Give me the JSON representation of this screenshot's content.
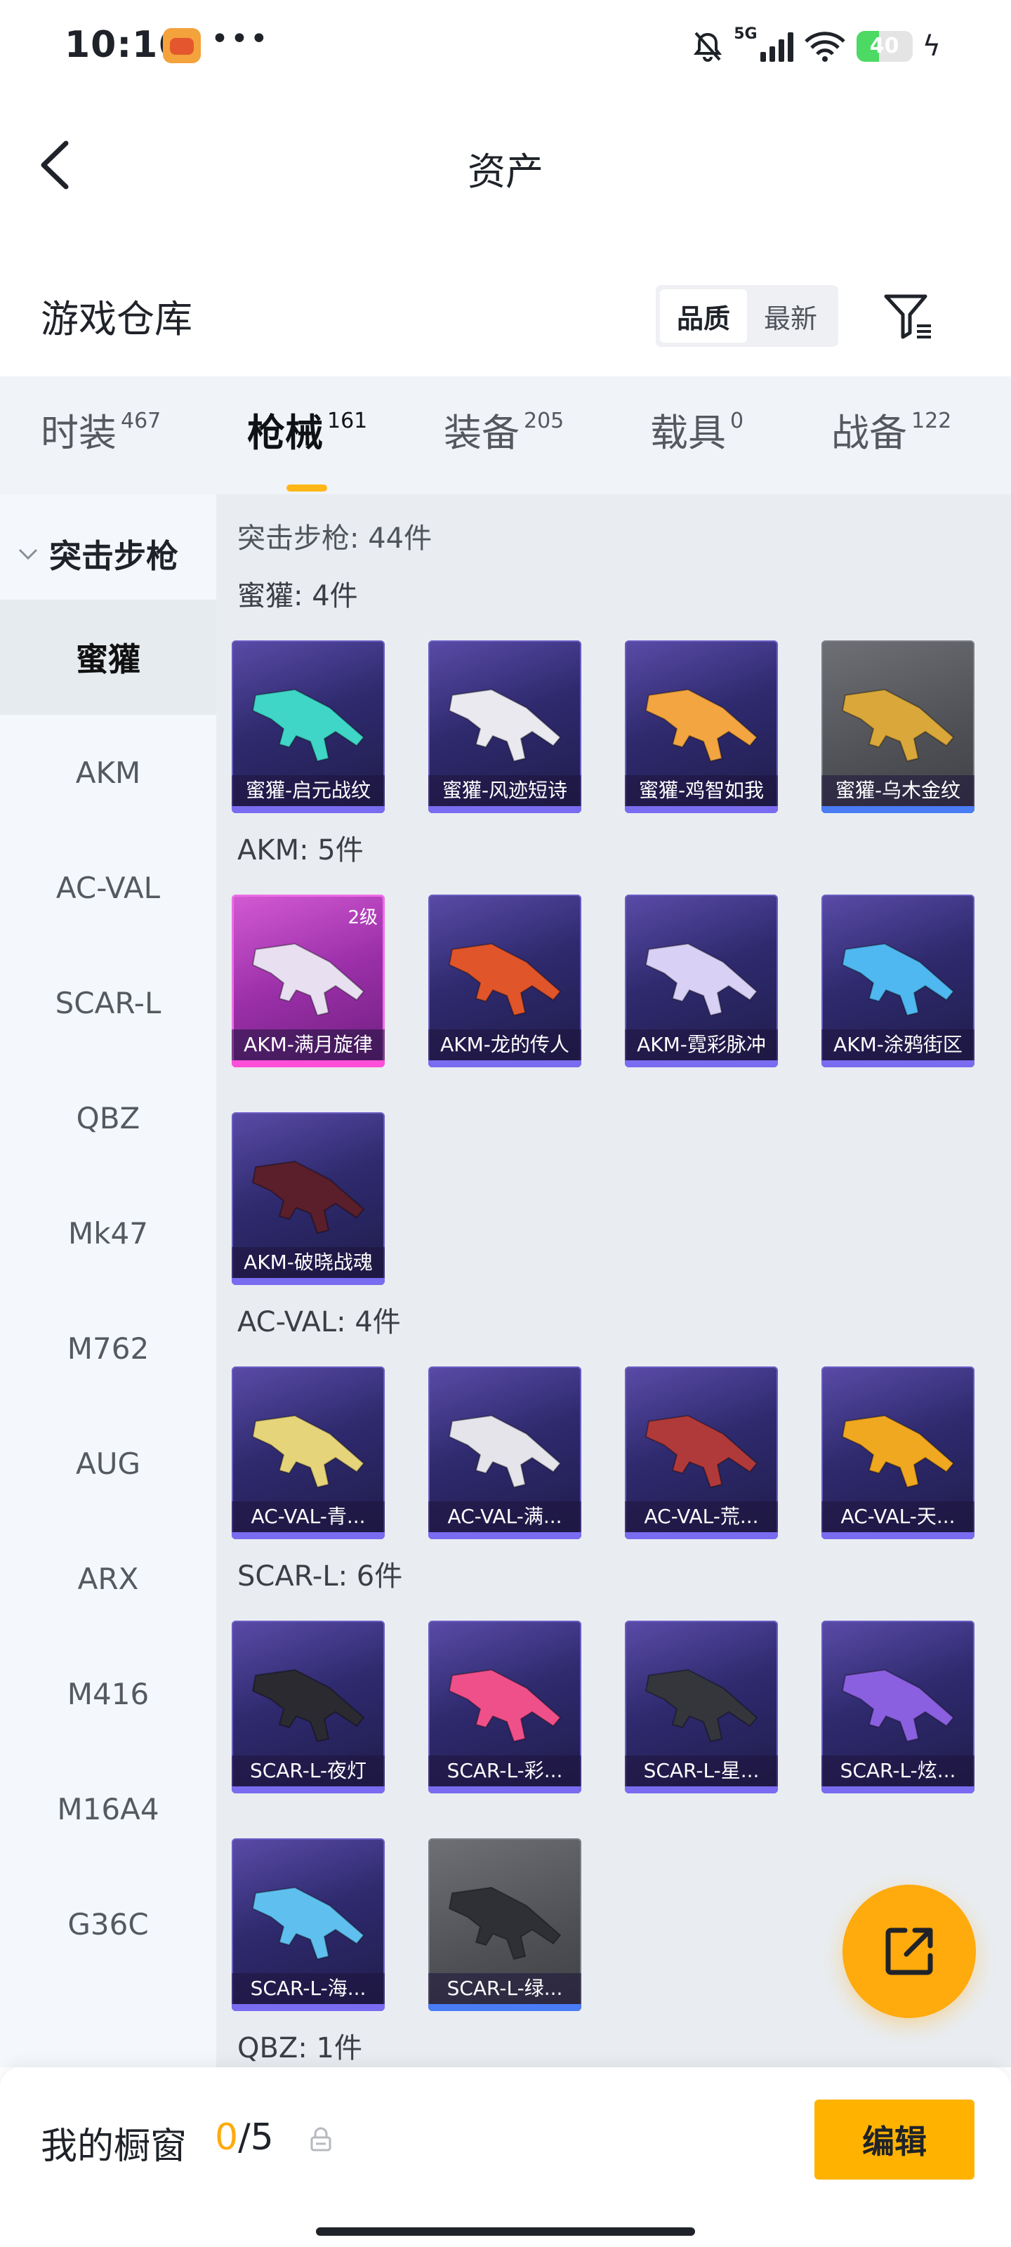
{
  "status": {
    "time": "10:16",
    "network": "5G",
    "battery": "40",
    "battery_level": 0.4
  },
  "header": {
    "title": "资产"
  },
  "warehouse": {
    "title": "游戏仓库",
    "sort_options": [
      "品质",
      "最新"
    ]
  },
  "tabs": [
    {
      "label": "时装",
      "count": "467"
    },
    {
      "label": "枪械",
      "count": "161"
    },
    {
      "label": "装备",
      "count": "205"
    },
    {
      "label": "载具",
      "count": "0"
    },
    {
      "label": "战备",
      "count": "122"
    }
  ],
  "sidebar": {
    "category": "突击步枪",
    "items": [
      "蜜獾",
      "AKM",
      "AC-VAL",
      "SCAR-L",
      "QBZ",
      "Mk47",
      "M762",
      "AUG",
      "ARX",
      "M416",
      "M16A4",
      "G36C"
    ]
  },
  "content": {
    "total": "突击步枪: 44件",
    "groups": [
      {
        "title": "蜜獾: 4件",
        "cards": [
          {
            "name": "蜜獾-启元战纹",
            "style": "purple",
            "gun_color": "#3fd6c8"
          },
          {
            "name": "蜜獾-风迹短诗",
            "style": "purple",
            "gun_color": "#e9e9ef"
          },
          {
            "name": "蜜獾-鸡智如我",
            "style": "purple",
            "gun_color": "#f2a540"
          },
          {
            "name": "蜜獾-乌木金纹",
            "style": "gray",
            "gun_color": "#d9a73a"
          }
        ]
      },
      {
        "title": "AKM: 5件",
        "cards": [
          {
            "name": "AKM-满月旋律",
            "style": "pink",
            "gun_color": "#e8e0f0",
            "level": "2级"
          },
          {
            "name": "AKM-龙的传人",
            "style": "purple",
            "gun_color": "#e0552a"
          },
          {
            "name": "AKM-霓彩脉冲",
            "style": "purple",
            "gun_color": "#d9d0f5"
          },
          {
            "name": "AKM-涂鸦街区",
            "style": "purple",
            "gun_color": "#4fb8f0"
          },
          {
            "name": "AKM-破晓战魂",
            "style": "purple",
            "gun_color": "#5a1f2a"
          }
        ]
      },
      {
        "title": "AC-VAL: 4件",
        "cards": [
          {
            "name": "AC-VAL-青...",
            "style": "purple",
            "gun_color": "#e6d47a"
          },
          {
            "name": "AC-VAL-满...",
            "style": "purple",
            "gun_color": "#e4e4ea"
          },
          {
            "name": "AC-VAL-荒...",
            "style": "purple",
            "gun_color": "#b03a3a"
          },
          {
            "name": "AC-VAL-天...",
            "style": "purple",
            "gun_color": "#f0a820"
          }
        ]
      },
      {
        "title": "SCAR-L: 6件",
        "cards": [
          {
            "name": "SCAR-L-夜灯",
            "style": "purple",
            "gun_color": "#2a2a30"
          },
          {
            "name": "SCAR-L-彩...",
            "style": "purple",
            "gun_color": "#f0508a"
          },
          {
            "name": "SCAR-L-星...",
            "style": "purple",
            "gun_color": "#35363c"
          },
          {
            "name": "SCAR-L-炫...",
            "style": "purple",
            "gun_color": "#8a60e0"
          },
          {
            "name": "SCAR-L-海...",
            "style": "purple",
            "gun_color": "#5fc0f0"
          },
          {
            "name": "SCAR-L-绿...",
            "style": "gray",
            "gun_color": "#2e3036"
          }
        ]
      },
      {
        "title": "QBZ: 1件",
        "cards": []
      }
    ]
  },
  "bottom": {
    "label": "我的橱窗",
    "current": "0",
    "max": "/5",
    "edit_label": "编辑"
  },
  "colors": {
    "accent": "#ffb300",
    "tab_underline": "#ffb617"
  }
}
